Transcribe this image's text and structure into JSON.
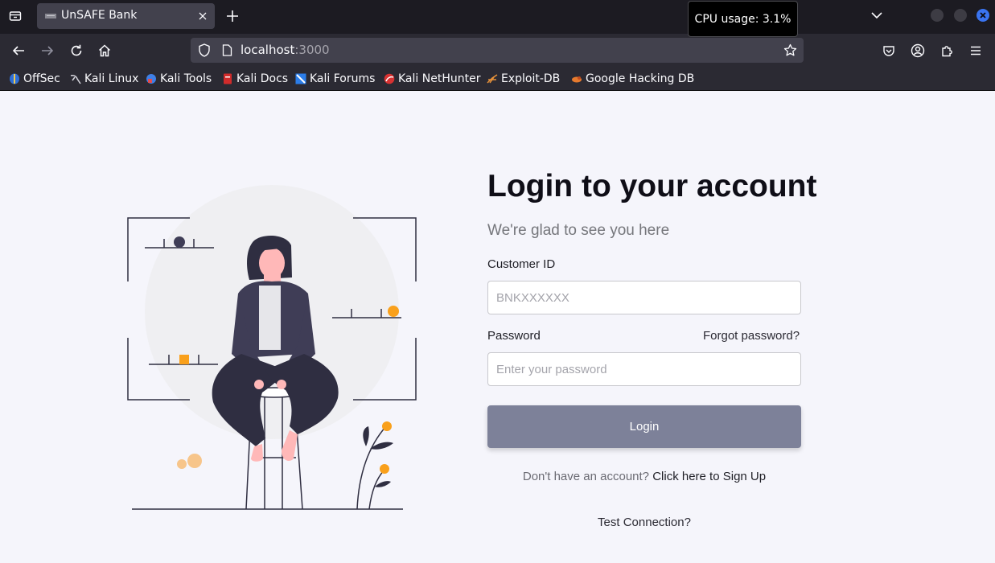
{
  "browser": {
    "tab": {
      "title": "UnSAFE Bank"
    },
    "tooltip": {
      "text": "CPU usage: 3.1%"
    },
    "url": {
      "host": "localhost",
      "port": ":3000"
    },
    "bookmarks": [
      {
        "label": "OffSec",
        "icon": "offsec-icon"
      },
      {
        "label": "Kali Linux",
        "icon": "kali-linux-icon"
      },
      {
        "label": "Kali Tools",
        "icon": "kali-tools-icon"
      },
      {
        "label": "Kali Docs",
        "icon": "kali-docs-icon"
      },
      {
        "label": "Kali Forums",
        "icon": "kali-forums-icon"
      },
      {
        "label": "Kali NetHunter",
        "icon": "kali-nethunter-icon"
      },
      {
        "label": "Exploit-DB",
        "icon": "exploit-db-icon"
      },
      {
        "label": "Google Hacking DB",
        "icon": "google-hacking-db-icon"
      }
    ]
  },
  "login": {
    "heading": "Login to your account",
    "subheading": "We're glad to see you here",
    "customer_id_label": "Customer ID",
    "customer_id_placeholder": "BNKXXXXXX",
    "customer_id_value": "",
    "password_label": "Password",
    "forgot_password": "Forgot password?",
    "password_placeholder": "Enter your password",
    "password_value": "",
    "login_button": "Login",
    "signup_prompt": "Don't have an account?",
    "signup_link": "Click here to Sign Up",
    "test_connection": "Test Connection?"
  },
  "colors": {
    "accent_button": "#7d8199",
    "page_background": "#f5f5fb",
    "illustration_orange": "#f9a01b",
    "illustration_dark": "#2f2e41"
  }
}
